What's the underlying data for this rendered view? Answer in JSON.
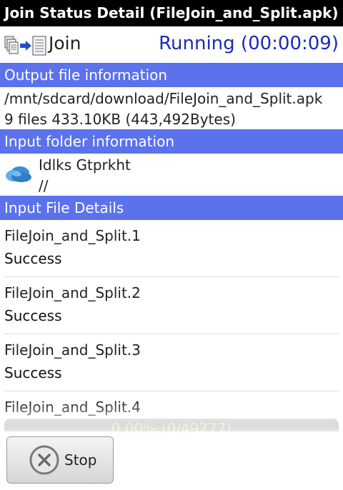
{
  "app": {
    "title": "Join Status Detail (FileJoin_and_Split.apk)"
  },
  "header": {
    "mode_label": "Join",
    "status": "Running (00:00:09)",
    "status_color": "#1a2cb4"
  },
  "sections": {
    "output": "Output file information",
    "input_folder": "Input folder information",
    "input_files": "Input File Details",
    "accent_color": "#5b72ec"
  },
  "output": {
    "path": "/mnt/sdcard/download/FileJoin_and_Split.apk",
    "summary": "9 files 433.10KB (443,492Bytes)"
  },
  "input_folder": {
    "icon": "skydrive-cloud-icon",
    "name": "Idlks Gtprkht",
    "path": "//"
  },
  "files": [
    {
      "name": "FileJoin_and_Split.1",
      "status": "Success"
    },
    {
      "name": "FileJoin_and_Split.2",
      "status": "Success"
    },
    {
      "name": "FileJoin_and_Split.3",
      "status": "Success"
    },
    {
      "name": "FileJoin_and_Split.4",
      "status": ""
    }
  ],
  "progress": {
    "text": "0.00% (0/49277)",
    "fraction": 0
  },
  "actions": {
    "stop_label": "Stop"
  }
}
